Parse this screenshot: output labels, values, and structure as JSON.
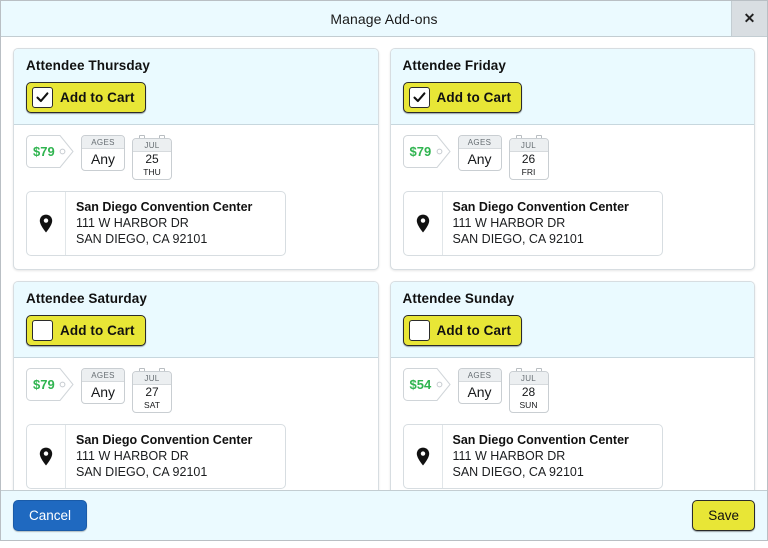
{
  "dialog": {
    "title": "Manage Add-ons",
    "close_label": "✕"
  },
  "colors": {
    "header_bg": "#ebfaff",
    "card_header_bg": "#eafaff",
    "accent_yellow": "#e8e636",
    "price_green": "#30b450",
    "cancel_blue": "#1f69c0"
  },
  "cards": [
    {
      "title": "Attendee Thursday",
      "cart_label": "Add to Cart",
      "checked": true,
      "price": "$79",
      "ages_label": "AGES",
      "ages_value": "Any",
      "month": "JUL",
      "day": "25",
      "weekday": "THU",
      "venue_name": "San Diego Convention Center",
      "venue_street": "111 W HARBOR DR",
      "venue_citystate": "SAN DIEGO, CA 92101"
    },
    {
      "title": "Attendee Friday",
      "cart_label": "Add to Cart",
      "checked": true,
      "price": "$79",
      "ages_label": "AGES",
      "ages_value": "Any",
      "month": "JUL",
      "day": "26",
      "weekday": "FRI",
      "venue_name": "San Diego Convention Center",
      "venue_street": "111 W HARBOR DR",
      "venue_citystate": "SAN DIEGO, CA 92101"
    },
    {
      "title": "Attendee Saturday",
      "cart_label": "Add to Cart",
      "checked": false,
      "price": "$79",
      "ages_label": "AGES",
      "ages_value": "Any",
      "month": "JUL",
      "day": "27",
      "weekday": "SAT",
      "venue_name": "San Diego Convention Center",
      "venue_street": "111 W HARBOR DR",
      "venue_citystate": "SAN DIEGO, CA 92101"
    },
    {
      "title": "Attendee Sunday",
      "cart_label": "Add to Cart",
      "checked": false,
      "price": "$54",
      "ages_label": "AGES",
      "ages_value": "Any",
      "month": "JUL",
      "day": "28",
      "weekday": "SUN",
      "venue_name": "San Diego Convention Center",
      "venue_street": "111 W HARBOR DR",
      "venue_citystate": "SAN DIEGO, CA 92101"
    }
  ],
  "footer": {
    "cancel_label": "Cancel",
    "save_label": "Save"
  }
}
